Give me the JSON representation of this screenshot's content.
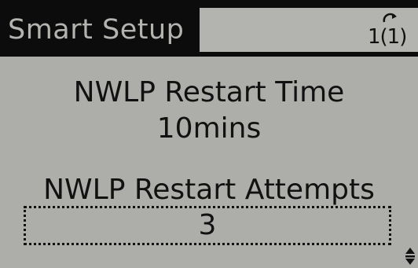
{
  "header": {
    "title": "Smart Setup",
    "menu_number": "1(1)"
  },
  "parameters": [
    {
      "label": "NWLP Restart Time",
      "value": "10mins"
    },
    {
      "label": "NWLP Restart Attempts",
      "value": "3"
    }
  ],
  "icons": {
    "menu_icon": "home-arrow-icon",
    "scroll_icon": "up-down-arrow-icon"
  }
}
